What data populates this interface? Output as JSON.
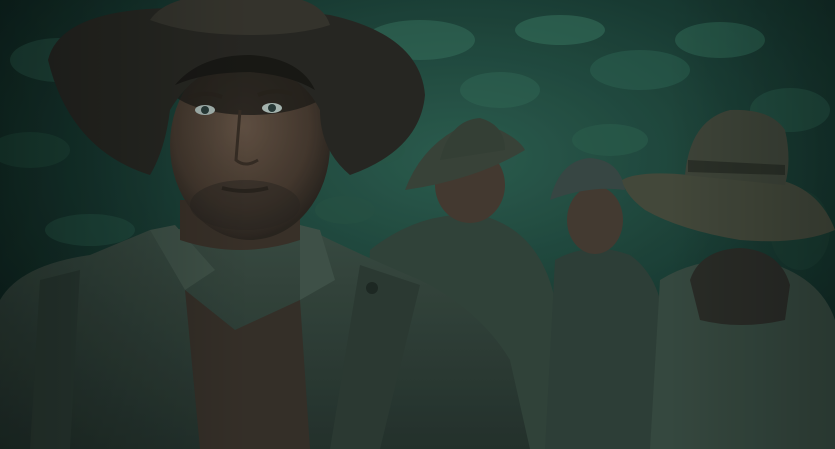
{
  "scene": {
    "palette": {
      "foliage_dark": "#0e1f1b",
      "foliage_mid": "#1f4a3e",
      "foliage_light": "#3f7a66",
      "uniform": "#3c4a40",
      "uniform_shadow": "#222b26",
      "hat": "#2a2420",
      "hat_khaki": "#4a4a3c",
      "skin": "#5a4438",
      "helmet": "#3d4846"
    },
    "figures": [
      {
        "role": "foreground-soldier-slouch-hat"
      },
      {
        "role": "background-soldier-slouch-hat"
      },
      {
        "role": "background-soldier-helmet"
      },
      {
        "role": "background-soldier-khaki-hat"
      }
    ]
  }
}
